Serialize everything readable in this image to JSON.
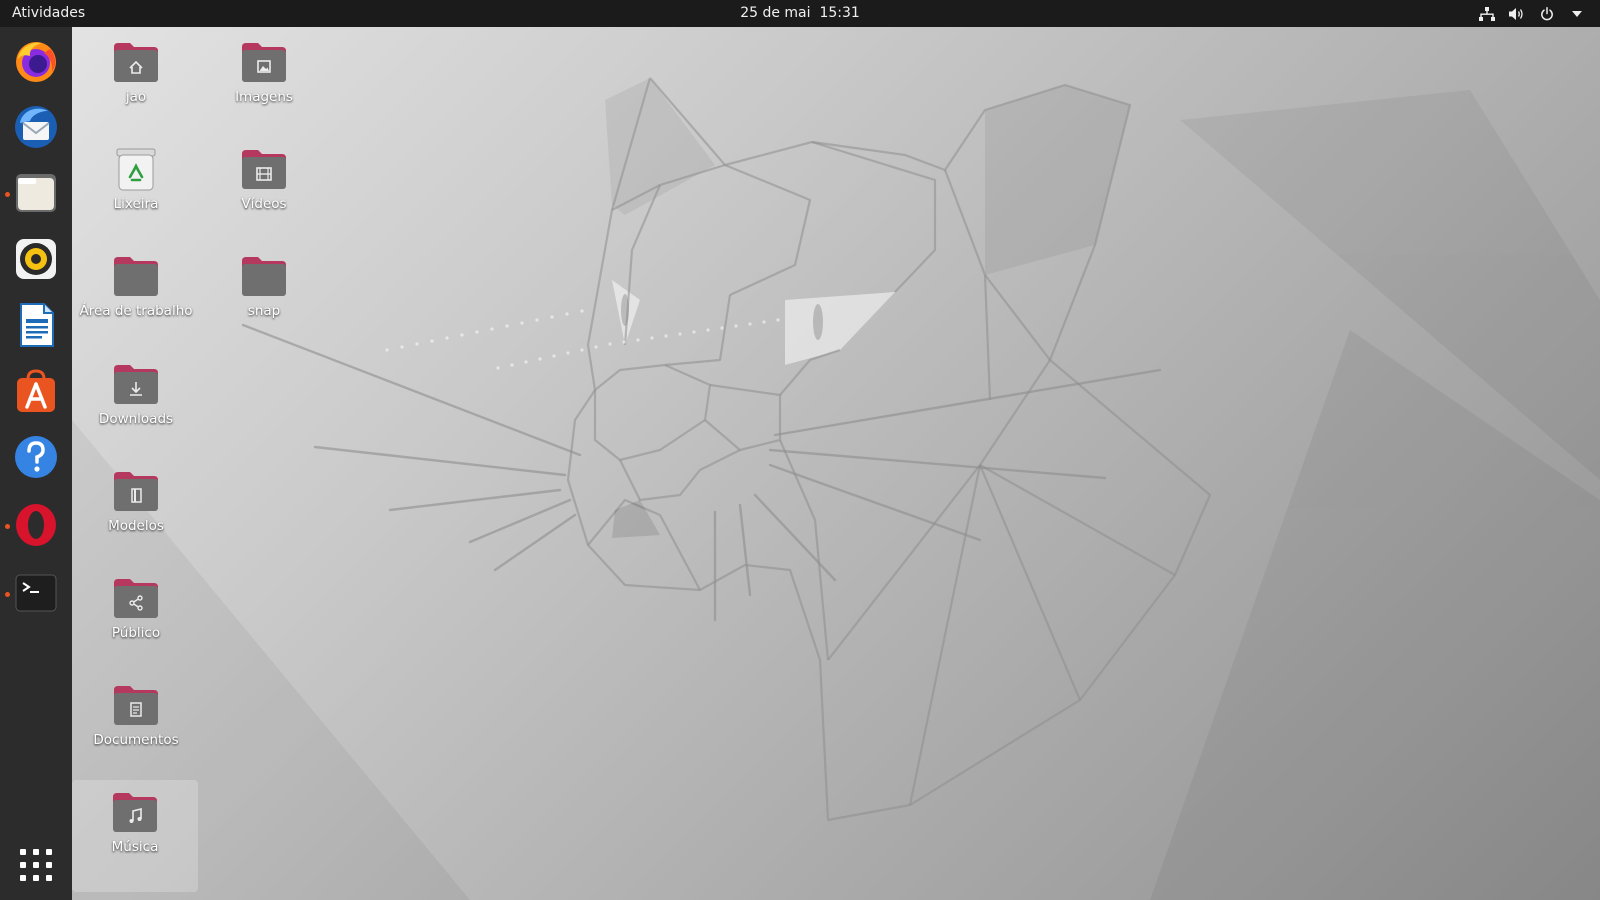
{
  "topbar": {
    "activities": "Atividades",
    "date": "25 de mai",
    "time": "15:31",
    "tray_icons": [
      "network-icon",
      "volume-icon",
      "power-icon",
      "menu-arrow-icon"
    ]
  },
  "dock": {
    "items": [
      {
        "name": "firefox",
        "icon": "firefox-icon",
        "running": false
      },
      {
        "name": "thunderbird",
        "icon": "thunderbird-icon",
        "running": false
      },
      {
        "name": "files",
        "icon": "files-icon",
        "running": true
      },
      {
        "name": "rhythmbox",
        "icon": "rhythmbox-icon",
        "running": false
      },
      {
        "name": "libreoffice-writer",
        "icon": "writer-icon",
        "running": false
      },
      {
        "name": "ubuntu-software",
        "icon": "software-icon",
        "running": false
      },
      {
        "name": "help",
        "icon": "help-icon",
        "running": false
      },
      {
        "name": "opera",
        "icon": "opera-icon",
        "running": true
      },
      {
        "name": "terminal",
        "icon": "terminal-icon",
        "running": true
      }
    ],
    "show_apps_icon": "grid-icon"
  },
  "desktop": {
    "icons": [
      {
        "label": "jao",
        "icon": "home-folder-icon"
      },
      {
        "label": "Imagens",
        "icon": "pictures-folder-icon"
      },
      {
        "label": "Lixeira",
        "icon": "trash-icon"
      },
      {
        "label": "Vídeos",
        "icon": "videos-folder-icon"
      },
      {
        "label": "Área de trabalho",
        "icon": "folder-icon"
      },
      {
        "label": "snap",
        "icon": "folder-icon"
      },
      {
        "label": "Downloads",
        "icon": "downloads-folder-icon"
      },
      {
        "label": "Modelos",
        "icon": "templates-folder-icon"
      },
      {
        "label": "Público",
        "icon": "public-folder-icon"
      },
      {
        "label": "Documentos",
        "icon": "documents-folder-icon"
      },
      {
        "label": "Música",
        "icon": "music-folder-icon",
        "selected": true
      }
    ]
  },
  "colors": {
    "topbar": "#1b1b1b",
    "dock": "#2c2c2c",
    "accent": "#e95420",
    "folder_tab": "#b5385f",
    "folder_body": "#6f6f6f"
  }
}
